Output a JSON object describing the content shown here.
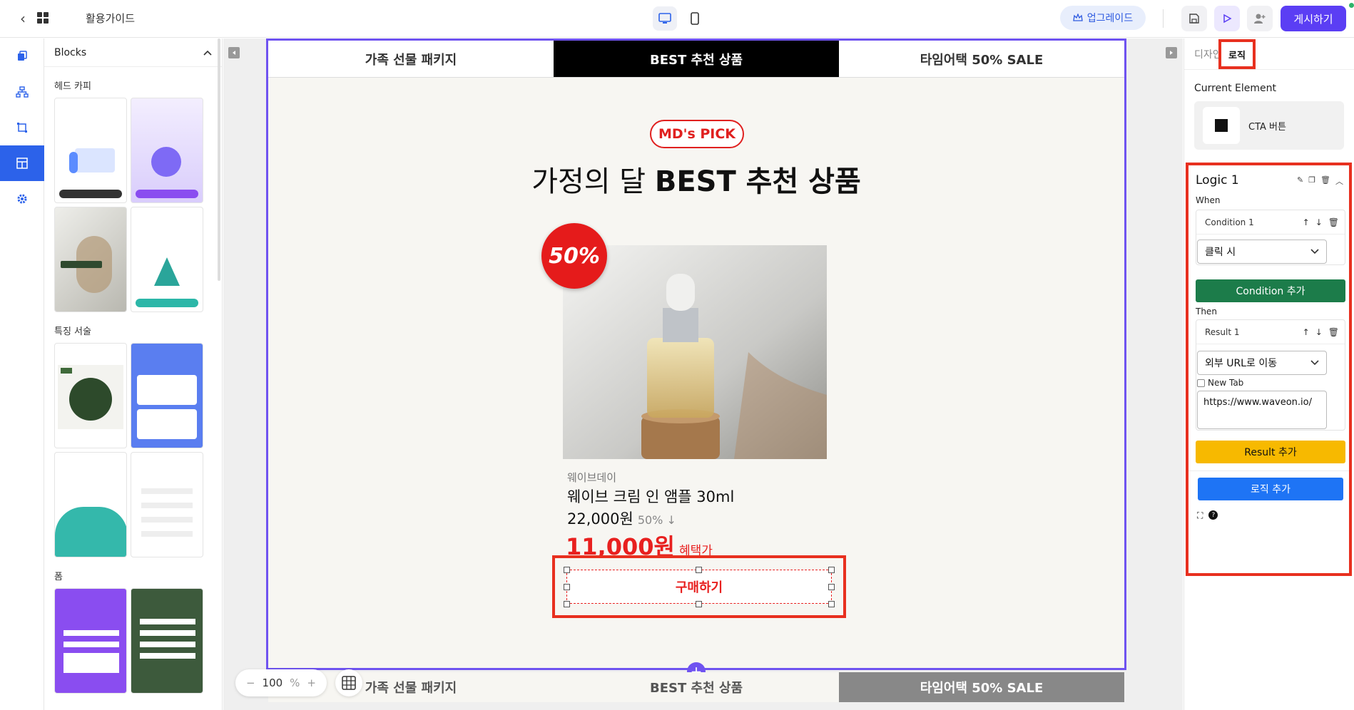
{
  "header": {
    "back_icon": "chevron-left-icon",
    "apps_icon": "grid-icon",
    "title": "활용가이드",
    "device_desktop_icon": "desktop-icon",
    "device_mobile_icon": "mobile-icon",
    "upgrade_label": "업그레이드",
    "upgrade_icon": "crown-icon",
    "save_icon": "save-icon",
    "play_icon": "play-icon",
    "invite_icon": "user-add-icon",
    "publish_label": "게시하기"
  },
  "left_rail": {
    "items": [
      {
        "name": "pages-icon"
      },
      {
        "name": "sitemap-icon"
      },
      {
        "name": "frame-icon"
      },
      {
        "name": "blocks-icon",
        "active": true
      },
      {
        "name": "settings-icon"
      }
    ]
  },
  "blocks_panel": {
    "title": "Blocks",
    "sections": [
      "헤드 카피",
      "특징 서술",
      "폼"
    ]
  },
  "canvas": {
    "tabs": [
      "가족 선물 패키지",
      "BEST 추천 상품",
      "타임어택 50% SALE"
    ],
    "active_tab": 1,
    "badge": "MD's PICK",
    "headline_normal": "가정의 달 ",
    "headline_bold": "BEST 추천 상품",
    "discount_badge": "50%",
    "brand": "웨이브데이",
    "product_name": "웨이브 크림 인 앰플 30ml",
    "price": "22,000원",
    "discount_text": "50% ↓",
    "sale_price": "11,000원",
    "sale_suffix": "혜택가",
    "cta_label": "구매하기",
    "bottom_tabs": [
      "가족 선물 패키지",
      "BEST 추천 상품",
      "타임어택 50% SALE"
    ],
    "zoom_minus": "−",
    "zoom_value": "100",
    "zoom_unit": "%",
    "zoom_plus": "+",
    "add_section": "+"
  },
  "right_panel": {
    "tab_design": "디자인",
    "tab_logic": "로직",
    "current_element_label": "Current Element",
    "current_element_name": "CTA 버튼",
    "logic_title": "Logic 1",
    "when_label": "When",
    "condition_title": "Condition 1",
    "condition_value": "클릭 시",
    "condition_add": "Condition 추가",
    "then_label": "Then",
    "result_title": "Result 1",
    "result_value": "외부 URL로 이동",
    "new_tab_label": "New Tab",
    "url_value": "https://www.waveon.io/",
    "result_add": "Result 추가",
    "logic_add": "로직 추가"
  },
  "colors": {
    "accent": "#5b3ef4",
    "frame": "#6f53f0",
    "sale_red": "#e8201f",
    "highlight": "#e8301f",
    "green_btn": "#1c7c4a",
    "yellow_btn": "#f7b900",
    "blue_btn": "#1e74f5"
  }
}
